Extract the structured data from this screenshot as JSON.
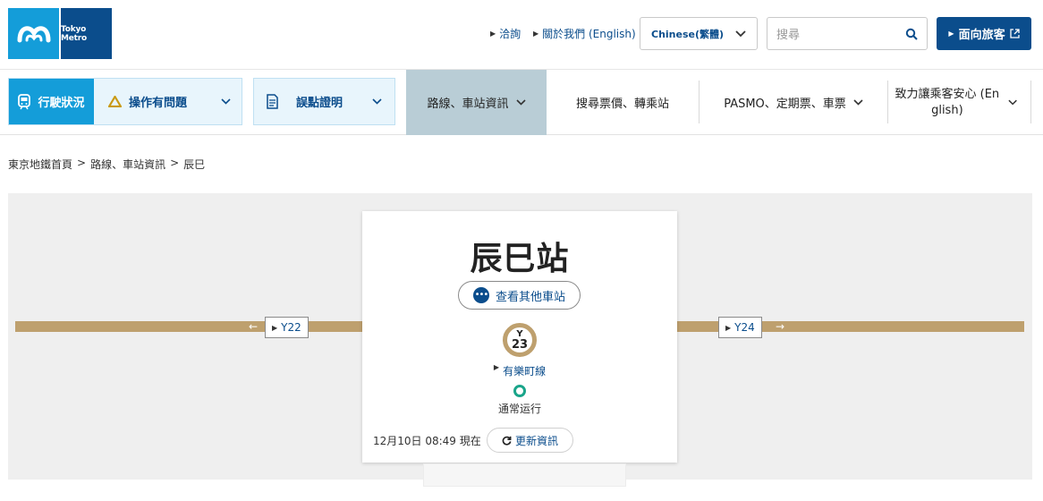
{
  "brand": {
    "logo_text": "Tokyo Metro"
  },
  "header": {
    "links": [
      {
        "label": "洽詢"
      },
      {
        "label": "關於我們 (English)"
      }
    ],
    "language": "Chinese(繁體)",
    "search_placeholder": "搜尋",
    "cta_label": "面向旅客"
  },
  "nav": {
    "status_label": "行駛狀況",
    "status_sub_label": "操作有問題",
    "delay_label": "誤點證明",
    "tabs": [
      {
        "label": "路線、車站資訊",
        "active": true
      },
      {
        "label": "搜尋票價、轉乘站"
      },
      {
        "label": "PASMO、定期票、車票"
      },
      {
        "label": "致力讓乘客安心 (English)"
      }
    ]
  },
  "breadcrumb": [
    "東京地鐵首頁",
    "路線、車站資訊",
    "辰巳"
  ],
  "station": {
    "name": "辰巳站",
    "other_stations_label": "查看其他車站",
    "line_letter": "Y",
    "number": "23",
    "line_name": "有樂町線",
    "status": "通常运行",
    "timestamp": "12月10日 08:49 現在",
    "refresh_label": "更新資訊",
    "prev_station": "Y22",
    "next_station": "Y24"
  },
  "colors": {
    "brand_blue": "#0b4d8c",
    "light_blue": "#149dd9",
    "line_gold": "#bea06e",
    "status_green": "#1aa58a",
    "warning_yellow": "#c99a14"
  }
}
